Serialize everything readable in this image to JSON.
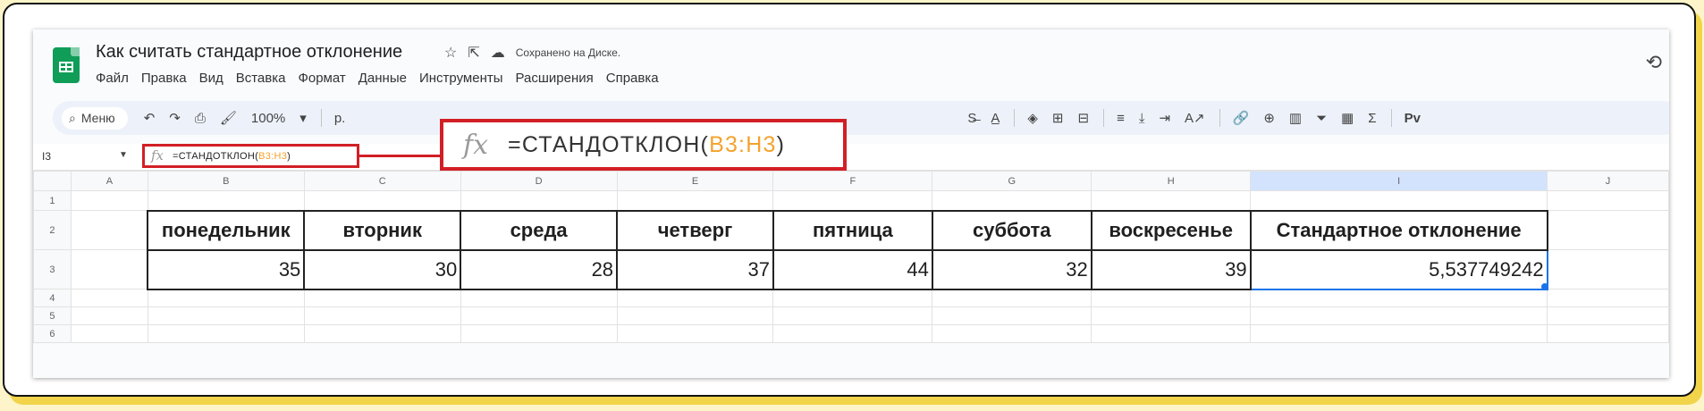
{
  "doc": {
    "title": "Как считать стандартное отклонение",
    "saved_status": "Сохранено на Диске."
  },
  "menu": [
    "Файл",
    "Правка",
    "Вид",
    "Вставка",
    "Формат",
    "Данные",
    "Инструменты",
    "Расширения",
    "Справка"
  ],
  "toolbar": {
    "search_label": "Меню",
    "zoom": "100%",
    "currency": "р.",
    "assistant": "Pv"
  },
  "formula_bar": {
    "cell_ref": "I3",
    "fx": "fx",
    "formula_prefix": "=СТАНДОТКЛОН(",
    "formula_range": "B3:H3",
    "formula_suffix": ")"
  },
  "columns": [
    "A",
    "B",
    "C",
    "D",
    "E",
    "F",
    "G",
    "H",
    "I",
    "J"
  ],
  "rows": [
    "1",
    "2",
    "3",
    "4",
    "5",
    "6"
  ],
  "table": {
    "headers": [
      "понедельник",
      "вторник",
      "среда",
      "четверг",
      "пятница",
      "суббота",
      "воскресенье",
      "Стандартное отклонение"
    ],
    "values": [
      "35",
      "30",
      "28",
      "37",
      "44",
      "32",
      "39",
      "5,537749242"
    ]
  },
  "selected_column": "I",
  "icons": [
    "sheets-logo-icon",
    "star-icon",
    "move-to-folder-icon",
    "cloud-saved-icon",
    "version-history-icon",
    "search-icon",
    "undo-icon",
    "redo-icon",
    "print-icon",
    "paint-format-icon",
    "fx-icon"
  ]
}
